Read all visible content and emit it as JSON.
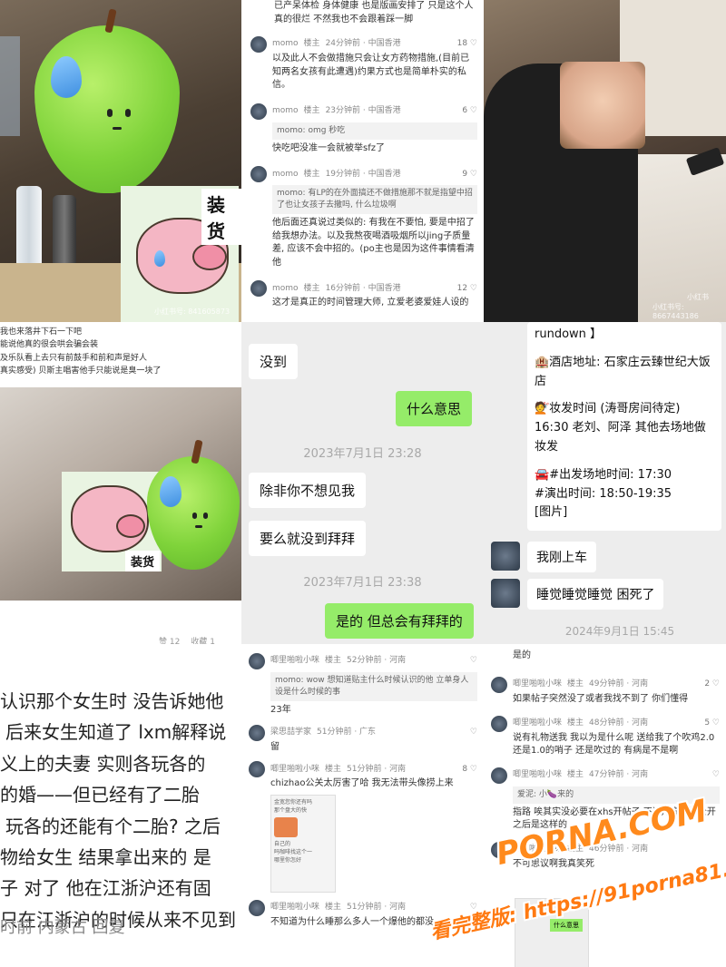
{
  "panel_tl": {
    "sticker_text": "装货",
    "watermark": "小红书号: 841605873"
  },
  "panel_tm": {
    "top_text": "已产呆体检 身体健康 也是版画安排了 只是这个人真的很烂 不然我也不会跟着踩一脚",
    "comments": [
      {
        "name": "momo",
        "badge": "楼主",
        "meta": "24分钟前 · 中国香港",
        "likes": "18",
        "quote": "",
        "text": "以及此人不会做措施只会让女方药物措施,(目前已知两名女孩有此遭遇)约果方式也是简单朴实的私信。"
      },
      {
        "name": "momo",
        "badge": "楼主",
        "meta": "23分钟前 · 中国香港",
        "likes": "6",
        "quote": "momo: omg 秒吃",
        "text": "快吃吧没准一会就被举sfz了"
      },
      {
        "name": "momo",
        "badge": "楼主",
        "meta": "19分钟前 · 中国香港",
        "likes": "9",
        "quote": "momo: 有LP的在外面搞还不做措施那不就是指望中招了也让女孩子去撒吗, 什么垃圾啊",
        "text": "他后面还真说过类似的: 有我在不要怕, 要是中招了给我想办法。以及我熬夜喝酒吸烟所以jing子质量差, 应该不会中招的。(po主也是因为这件事情看清他"
      },
      {
        "name": "momo",
        "badge": "楼主",
        "meta": "16分钟前 · 中国香港",
        "likes": "12",
        "quote": "",
        "text": "这才是真正的时间管理大师, 立爱老婆爱娃人设的"
      }
    ]
  },
  "panel_tr": {
    "watermark": "小红书号: 8667443186",
    "logo": "小红书"
  },
  "panel_ml": {
    "lines": [
      "我也来落井下石一下吧",
      "能说他真的很会哄会骗会装",
      "及乐队看上去只有前鼓手和前和声是好人",
      "真实感受) 贝斯主唱害他手只能说是臭一块了"
    ],
    "sticker_text": "装货",
    "likes": "赞 12",
    "collect": "收藏 1"
  },
  "panel_mm": {
    "messages": [
      {
        "side": "them",
        "text": "没到"
      },
      {
        "side": "me",
        "text": "什么意思"
      },
      {
        "side": "ts",
        "text": "2023年7月1日 23:28"
      },
      {
        "side": "them",
        "text": "除非你不想见我"
      },
      {
        "side": "them",
        "text": "要么就没到拜拜"
      },
      {
        "side": "ts",
        "text": "2023年7月1日 23:38"
      },
      {
        "side": "me",
        "text": "是的 但总会有拜拜的"
      }
    ]
  },
  "panel_mr": {
    "schedule": [
      "rundown 】",
      "🏨酒店地址: 石家庄云臻世纪大饭店",
      "💇妆发时间 (涛哥房间待定) 16:30 老刘、阿泽 其他去场地做妆发",
      "🚘#出发场地时间: 17:30",
      "#演出时间: 18:50-19:35",
      "[图片]"
    ],
    "msg1": "我刚上车",
    "msg2": "睡觉睡觉睡觉 困死了",
    "timestamp": "2024年9月1日 15:45"
  },
  "panel_bl": {
    "lines": [
      "认识那个女生时 没告诉她他",
      "后来女生知道了 lxm解释说",
      "义上的夫妻 实则各玩各的",
      "的婚——但已经有了二胎",
      "玩各的还能有个二胎? 之后",
      "物给女生 结果拿出来的 是",
      "子 对了 他在江浙沪还有固",
      "只在江浙沪的时候从来不见到"
    ],
    "footer": "时前 内蒙古 回复"
  },
  "panel_bm": {
    "comments": [
      {
        "name": "唧里啪啦小咪",
        "badge": "楼主",
        "meta": "52分钟前 · 河南",
        "likes": "",
        "quote": "momo: wow 想知道贴主什么时候认识的他 立单身人设是什么时候的事",
        "text": "23年"
      },
      {
        "name": "梁思喆学家",
        "badge": "",
        "meta": "51分钟前 · 广东",
        "likes": "",
        "quote": "",
        "text": "留"
      },
      {
        "name": "唧里啪啦小咪",
        "badge": "楼主",
        "meta": "51分钟前 · 河南",
        "likes": "8",
        "quote": "",
        "text": "chizhao公关太厉害了哈 我无法带头像捞上来"
      },
      {
        "name": "唧里啪啦小咪",
        "badge": "楼主",
        "meta": "51分钟前 · 河南",
        "likes": "",
        "quote": "",
        "text": "不知道为什么睡那么多人一个爆他的都没"
      }
    ],
    "img_text": [
      "金宽您你还有吗",
      "那个盘大的快",
      "自己的",
      "吗咖啡找这个一",
      "哪里你怎好"
    ]
  },
  "panel_br": {
    "top": "是的",
    "comments": [
      {
        "name": "唧里啪啦小咪",
        "badge": "楼主",
        "meta": "49分钟前 · 河南",
        "likes": "2",
        "quote": "",
        "text": "如果帖子突然没了或者我找不到了 你们懂得"
      },
      {
        "name": "唧里啪啦小咪",
        "badge": "楼主",
        "meta": "48分钟前 · 河南",
        "likes": "5",
        "quote": "",
        "text": "说有礼物送我 我以为是什么呢 送给我了个吹鸡2.0还是1.0的哨子 还是吹过的 有病是不是啊"
      },
      {
        "name": "唧里啪啦小咪",
        "badge": "楼主",
        "meta": "47分钟前 · 河南",
        "likes": "",
        "quote": "爱泥: 小🍆来的",
        "text": "指路 唉其实没必要在xhs开帖子 不过月亮组转公开之后是这样的"
      },
      {
        "name": "唧里啪啦小咪",
        "badge": "楼主",
        "meta": "46分钟前 · 河南",
        "likes": "",
        "quote": "",
        "text": "不可思议啊我真笑死"
      }
    ],
    "bubble": "什么意思"
  },
  "watermark": {
    "line1": "PORNA.COM",
    "line2": "看完整版: https://91porna81.com"
  }
}
